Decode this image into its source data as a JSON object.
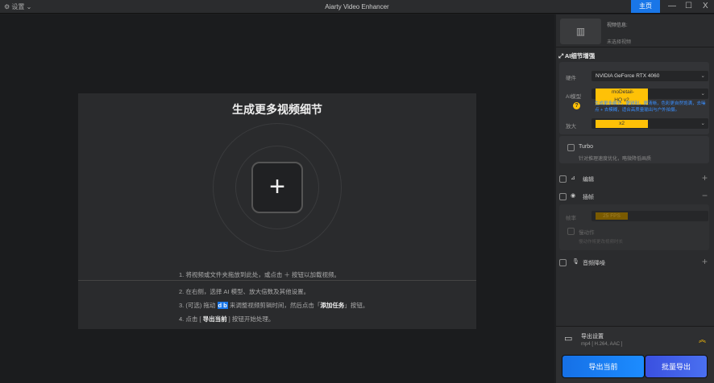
{
  "titlebar": {
    "settings": "设置",
    "title": "Aiarty Video Enhancer",
    "home": "主页",
    "minimize": "—",
    "maximize": "☐",
    "close": "X"
  },
  "main": {
    "heading": "生成更多视频细节",
    "add_icon": "+",
    "steps": {
      "s1": "1.  将视频或文件夹拖放到此处，或点击 ＋ 按钮以加载视频。",
      "s2": "2.  在右侧，选择 AI 模型、放大倍数及其他设置。",
      "s3a": "3.  (可选) 拖动",
      "s3b": "来调整视频剪辑时间，然后点击「",
      "s3c": "添加任务",
      "s3d": "」按钮。",
      "s4a": "4.  点击 [ ",
      "s4b": "导出当前",
      "s4c": " ] 按钮开始处理。"
    }
  },
  "side": {
    "video_info": "视频信息:",
    "no_video": "未选择视频",
    "ai_section": "AI细节增强",
    "hardware_label": "硬件",
    "hardware": "NVIDIA GeForce RTX 4060",
    "model_label": "AI模型",
    "model": "moDetail-HQ v2",
    "model_desc": "生成更多细节，更锐利，更清晰，色彩更自然饱满，去噪点 + 去模糊，适合高质量输出与户外拍摄。",
    "scale_label": "放大",
    "scale": "x2",
    "turbo": "Turbo",
    "turbo_desc": "针对推理速度优化，略微降低画质",
    "edit": "编辑",
    "interp": "插帧",
    "fps_label": "帧率",
    "fps": "25 FPS",
    "slowmo": "慢动作",
    "slowmo_desc": "慢动作将更改视频时长",
    "audio": "音频降噪",
    "export_title": "导出设置",
    "export_format": "mp4 [ H.264, AAC ]",
    "export_current": "导出当前",
    "batch_export": "批量导出"
  },
  "colors": {
    "accent": "#1976e8",
    "highlight": "#ffc107"
  }
}
